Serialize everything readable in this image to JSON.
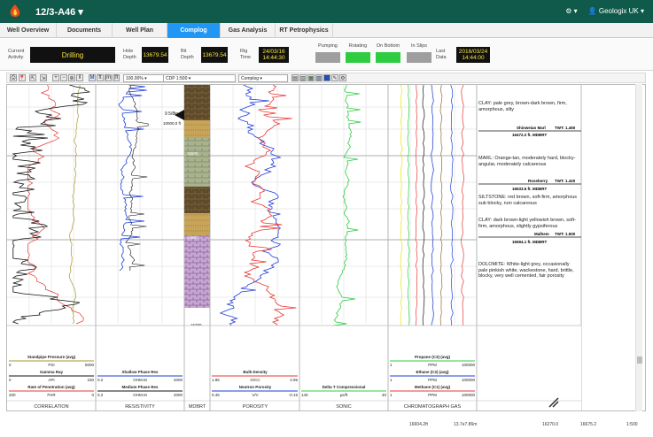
{
  "app": {
    "well_name": "12/3-A46 ▾",
    "settings_label": "⚙ ▾",
    "user_label": "👤 Geologix UK ▾"
  },
  "tabs": [
    {
      "label": "Well Overview",
      "active": false
    },
    {
      "label": "Documents",
      "active": false
    },
    {
      "label": "Well Plan",
      "active": false
    },
    {
      "label": "Complog",
      "active": true
    },
    {
      "label": "Gas Analysis",
      "active": false
    },
    {
      "label": "RT Petrophysics",
      "active": false
    }
  ],
  "status": {
    "current_activity_label": "Current Activity",
    "current_activity_value": "Drilling",
    "hole_depth_label": "Hole Depth",
    "hole_depth_value": "13679.54",
    "bit_depth_label": "Bit Depth",
    "bit_depth_value": "13679.54",
    "rig_time_label": "Rig Time",
    "rig_time_date": "24/03/16",
    "rig_time_time": "14:44:30",
    "pumping_label": "Pumping",
    "rotating_label": "Rotating",
    "on_bottom_label": "On Bottom",
    "in_slips_label": "In Slips",
    "last_data_label": "Last Data",
    "last_data_date": "2016/03/24",
    "last_data_time": "14:44:00",
    "colors": {
      "pumping": "#9e9e9e",
      "rotating": "#2ecc40",
      "on_bottom": "#2ecc40",
      "in_slips": "#9e9e9e"
    }
  },
  "toolbar": {
    "zoom_select": "100.00% ▾",
    "template_select": "CDP 1:500 ▾",
    "view_select": "Complog ▾",
    "unit_labels": [
      "M",
      "ft",
      "|m",
      "|ft"
    ]
  },
  "track_titles": [
    "CORRELATION",
    "RESISTIVITY",
    "MDBRT",
    "POROSITY",
    "SONIC",
    "CHROMATOGRAPH GAS"
  ],
  "depth_labels": {
    "casing": "9 5/8in",
    "casing_depth": "10000.0 ft",
    "d1": "16500",
    "d2": "16600",
    "d3": "16700"
  },
  "headers": {
    "standpipe": {
      "name": "Standpipe Pressure (avg)",
      "unit": "PSI",
      "min": "0",
      "max": "5000"
    },
    "gamma": {
      "name": "Gamma Ray",
      "unit": "API",
      "min": "0",
      "max": "150"
    },
    "rop": {
      "name": "Rate of Penetration (avg)",
      "unit": "FHR",
      "min": "200",
      "max": "0"
    },
    "shallow_res": {
      "name": "Shallow Phase Res",
      "unit": "OHM.M",
      "min": "0.2",
      "max": "2000"
    },
    "medium_res": {
      "name": "Medium Phase Res",
      "unit": "OHM.M",
      "min": "0.2",
      "max": "2000"
    },
    "bulk_density": {
      "name": "Bulk Density",
      "unit": "G/CC",
      "min": "1.95",
      "max": "2.95"
    },
    "neutron": {
      "name": "Neutron Porosity",
      "unit": "V/V",
      "min": "0.45",
      "max": "-0.15"
    },
    "delta_t": {
      "name": "Delta T Compressional",
      "unit": "µs/ft",
      "min": "140",
      "max": "40"
    },
    "propane": {
      "name": "Propane (C3) (avg)",
      "unit": "PPM",
      "min": "1",
      "max": "100000"
    },
    "ethane": {
      "name": "Ethane (C2) (avg)",
      "unit": "PPM",
      "min": "1",
      "max": "100000"
    },
    "methane": {
      "name": "Methane (C1) (avg)",
      "unit": "PPM",
      "min": "1",
      "max": "100000"
    }
  },
  "lithology_notes": [
    {
      "text": "CLAY: pale grey, brown-dark brown, firm, amorphous, silty"
    },
    {
      "text": "MARL: Orange-tan, moderately hard, blocky-angular, moderately calcareous"
    },
    {
      "text": "SILTSTONE: red brown, soft-firm, amorphous sub blocky, non calcareous"
    },
    {
      "text": "CLAY: dark brown-light yellowish brown, soft-firm, amorphous, slightly gypsiferous"
    },
    {
      "text": "DOLOMITE: White-light grey, occasionally pale pinkish white, wackestone, hard, brittle, blocky, very well cemented, fair porosity"
    }
  ],
  "formation_tops": [
    {
      "name": "Shinweian Marl",
      "twt": "TWT: 1.450",
      "depth": "16472.2 ft. MDBRT"
    },
    {
      "name": "Roseberry",
      "twt": "TWT: 1.420",
      "depth": "16533.6 ft. MDBRT"
    },
    {
      "name": "Malhem",
      "twt": "TWT: 1.500",
      "depth": "16594.1 ft. MDBRT"
    }
  ],
  "footer": {
    "depth": "16604.2ft",
    "coords": "13.7e7.86m",
    "v1": "16270.0",
    "v2": "16675.2",
    "scale": "1:500"
  }
}
